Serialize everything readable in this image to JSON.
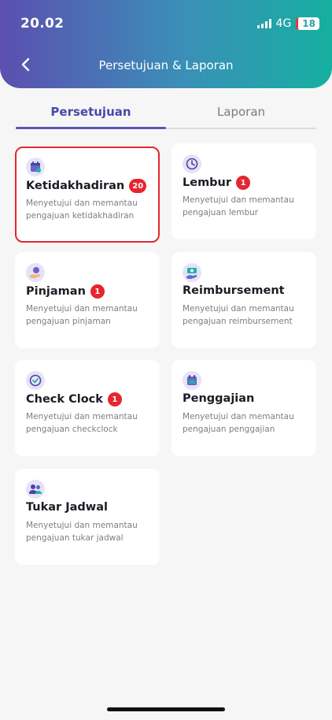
{
  "status_bar": {
    "time": "20.02",
    "network": "4G",
    "battery": "18"
  },
  "header": {
    "title": "Persetujuan & Laporan",
    "back_icon": "chevron-left-icon"
  },
  "tabs": [
    {
      "label": "Persetujuan",
      "active": true
    },
    {
      "label": "Laporan",
      "active": false
    }
  ],
  "cards": [
    {
      "title": "Ketidakhadiran",
      "badge": "20",
      "desc": "Menyetujui dan memantau pengajuan ketidakhadiran",
      "icon": "calendar-icon",
      "selected": true
    },
    {
      "title": "Lembur",
      "badge": "1",
      "desc": "Menyetujui dan memantau pengajuan lembur",
      "icon": "clock-icon",
      "selected": false
    },
    {
      "title": "Pinjaman",
      "badge": "1",
      "desc": "Menyetujui dan memantau pengajuan pinjaman",
      "icon": "loan-icon",
      "selected": false
    },
    {
      "title": "Reimbursement",
      "badge": "",
      "desc": "Menyetujui dan memantau pengajuan reimbursement",
      "icon": "cash-icon",
      "selected": false
    },
    {
      "title": "Check Clock",
      "badge": "1",
      "desc": "Menyetujui dan memantau pengajuan checkclock",
      "icon": "check-clock-icon",
      "selected": false
    },
    {
      "title": "Penggajian",
      "badge": "",
      "desc": "Menyetujui dan memantau pengajuan penggajian",
      "icon": "payroll-icon",
      "selected": false
    },
    {
      "title": "Tukar Jadwal",
      "badge": "",
      "desc": "Menyetujui dan memantau pengajuan tukar jadwal",
      "icon": "swap-people-icon",
      "selected": false
    }
  ],
  "colors": {
    "accent": "#4b48a8",
    "badge": "#e5262e",
    "header_start": "#5b4fb0",
    "header_end": "#15b0a0"
  }
}
